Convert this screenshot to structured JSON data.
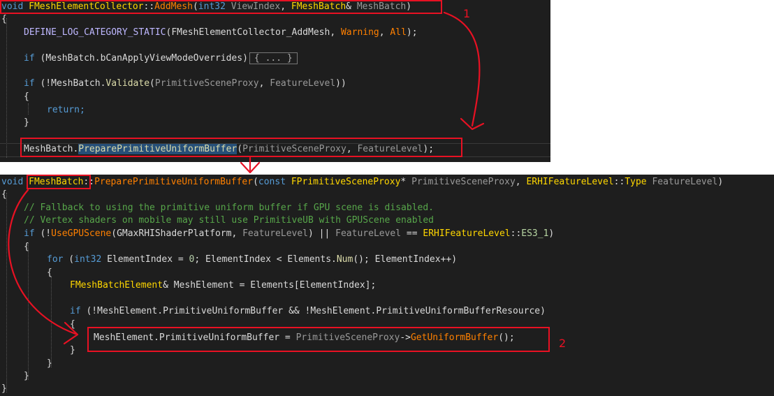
{
  "top_code": {
    "sig": {
      "void": "void",
      "class": "FMeshElementCollector",
      "scope": "::",
      "method": "AddMesh",
      "open": "(",
      "int": "int32",
      "p1": "ViewIndex",
      "comma": ", ",
      "type2": "FMeshBatch",
      "amp": "&",
      "p2": "MeshBatch",
      "close": ")"
    },
    "brace_open": "{",
    "define": {
      "macro": "DEFINE_LOG_CATEGORY_STATIC",
      "open": "(",
      "a1": "FMeshElementCollector_AddMesh",
      "c1": ", ",
      "a2": "Warning",
      "c2": ", ",
      "a3": "All",
      "end": ");"
    },
    "if1": {
      "kw": "if",
      "open": " (",
      "obj": "MeshBatch",
      "dot": ".",
      "member": "bCanApplyViewModeOverrides",
      "close": ")",
      "collapsed": "{ ... }"
    },
    "if2": {
      "kw": "if",
      "open": " (!",
      "obj": "MeshBatch",
      "dot": ".",
      "fn": "Validate",
      "p": "(",
      "a1": "PrimitiveSceneProxy",
      "c": ", ",
      "a2": "FeatureLevel",
      "end": "))"
    },
    "brace2_open": "{",
    "ret": "return;",
    "brace2_close": "}",
    "call": {
      "obj": "MeshBatch",
      "dot": ".",
      "fn": "PreparePrimitiveUniformBuffer",
      "p": "(",
      "a1": "PrimitiveSceneProxy",
      "c": ", ",
      "a2": "FeatureLevel",
      "end": ");"
    }
  },
  "bottom_code": {
    "sig": {
      "void": "void",
      "class": "FMeshBatch",
      "scope": "::",
      "fn": "PreparePrimitiveUniformBuffer",
      "open": "(",
      "const": "const",
      "t1": "FPrimitiveSceneProxy",
      "ptr": "*",
      "p1": "PrimitiveSceneProxy",
      "c": ", ",
      "t2": "ERHIFeatureLevel",
      "scope2": "::",
      "t3": "Type",
      "p2": "FeatureLevel",
      "close": ")"
    },
    "brace_open": "{",
    "comment1": "// Fallback to using the primitive uniform buffer if GPU scene is disabled.",
    "comment2": "// Vertex shaders on mobile may still use PrimitiveUB with GPUScene enabled",
    "if1": {
      "kw": "if",
      "open": " (!",
      "fn": "UseGPUScene",
      "p": "(",
      "a1": "GMaxRHIShaderPlatform",
      "c": ", ",
      "a2": "FeatureLevel",
      "mid": ") || ",
      "a3": "FeatureLevel",
      "eq": " == ",
      "t": "ERHIFeatureLevel",
      "scope": "::",
      "en": "ES3_1",
      "end": ")"
    },
    "brace1_open": "{",
    "for": {
      "kw": "for",
      "open": " (",
      "int": "int32",
      "v": "ElementIndex",
      "eq": " = ",
      "zero": "0",
      "semi": "; ",
      "v2": "ElementIndex",
      "lt": " < ",
      "obj": "Elements",
      "dot": ".",
      "fn": "Num",
      "call": "()",
      "semi2": "; ",
      "v3": "ElementIndex",
      "end": "++)"
    },
    "brace2_open": "{",
    "decl": {
      "type": "FMeshBatchElement",
      "amp": "& ",
      "v": "MeshElement",
      "eq": " = ",
      "obj": "Elements",
      "idx": "[",
      "i": "ElementIndex",
      "end": "];"
    },
    "if2": {
      "kw": "if",
      "open": " (!",
      "v1": "MeshElement",
      "dot1": ".",
      "m1": "PrimitiveUniformBuffer",
      "and": " && !",
      "v2": "MeshElement",
      "dot2": ".",
      "m2": "PrimitiveUniformBufferResource",
      "end": ")"
    },
    "brace3_open": "{",
    "assign": {
      "v": "MeshElement",
      "dot": ".",
      "m": "PrimitiveUniformBuffer",
      "eq": " = ",
      "p": "PrimitiveSceneProxy",
      "arrow": "->",
      "fn": "GetUniformBuffer",
      "end": "();"
    },
    "brace3_close": "}",
    "brace2_close": "}",
    "brace1_close": "}",
    "brace_close": "}"
  },
  "annotations": {
    "label1": "1",
    "label2": "2",
    "stroke_color": "#e81123"
  }
}
